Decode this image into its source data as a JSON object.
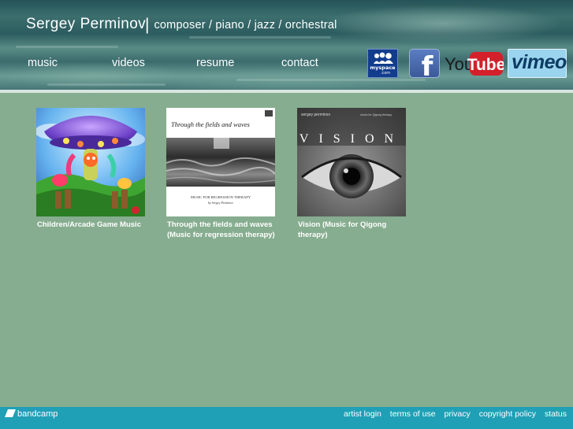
{
  "site": {
    "name_first": "Sergey",
    "name_last": "Perminov",
    "tagline_separator": "|",
    "tagline": "composer / piano / jazz / orchestral"
  },
  "nav": [
    {
      "label": "music"
    },
    {
      "label": "videos"
    },
    {
      "label": "resume"
    },
    {
      "label": "contact"
    }
  ],
  "social": {
    "myspace_text_1": "myspace",
    "myspace_text_2": ".com",
    "facebook_glyph": "f",
    "youtube_you": "You",
    "youtube_tube": "Tube",
    "vimeo": "vimeo"
  },
  "albums": [
    {
      "title": "Children/Arcade Game Music"
    },
    {
      "title": "Through the fields and waves (Music for regression therapy)",
      "cover_title": "Through the fields and waves",
      "cover_subtitle": "MUSIC FOR REGRESSION THERAPY",
      "cover_credit": "by Sergey Perminov"
    },
    {
      "title": "Vision (Music for Qigong therapy)",
      "cover_artist": "sergey perminov",
      "cover_word": "VISION",
      "cover_note": "music for Qigong therapy"
    }
  ],
  "footer": {
    "brand": "bandcamp",
    "links": [
      "artist login",
      "terms of use",
      "privacy",
      "copyright policy",
      "status"
    ]
  },
  "colors": {
    "page_bg": "#86ad8f",
    "footer_bg": "#1fa0b6",
    "header_dark": "#255357"
  }
}
